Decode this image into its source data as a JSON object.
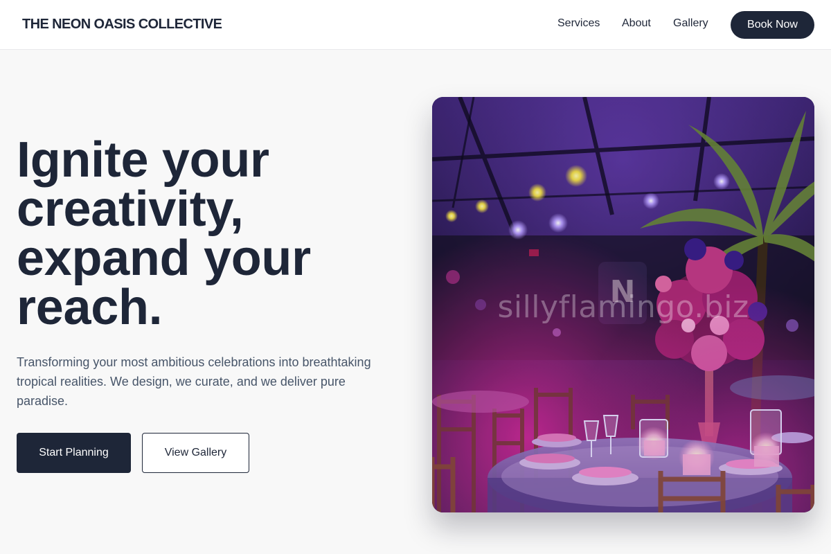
{
  "header": {
    "brand": "THE NEON OASIS COLLECTIVE",
    "nav": {
      "services": "Services",
      "about": "About",
      "gallery": "Gallery"
    },
    "cta": "Book Now"
  },
  "hero": {
    "headline_lines": [
      "Ignite your",
      "creativity,",
      "expand your",
      "reach."
    ],
    "description": "Transforming your most ambitious celebrations into breathtaking tropical realities. We design, we curate, and we deliver pure paradise.",
    "primary_button": "Start Planning",
    "secondary_button": "View Gallery",
    "image_watermark": "sillyflamingo.biz"
  },
  "colors": {
    "navy": "#1e2638",
    "body_text": "#475569",
    "page_bg": "#f8f8f8",
    "neon_magenta": "#e0289a",
    "neon_purple": "#6a2fc0"
  }
}
